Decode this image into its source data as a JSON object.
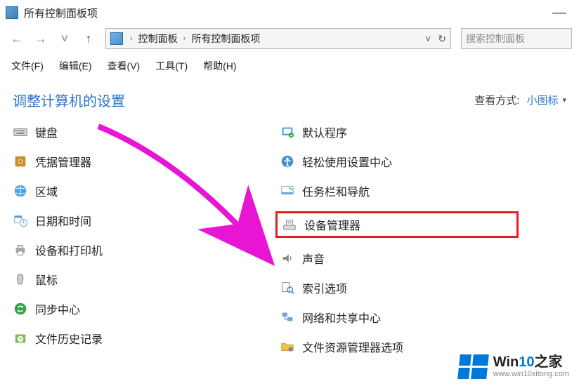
{
  "window": {
    "title": "所有控制面板项",
    "minimize": "—"
  },
  "nav": {
    "back_icon": "←",
    "forward_icon": "→",
    "up_icon": "↑",
    "dropdown_icon": "˅",
    "refresh_icon": "↻"
  },
  "breadcrumb": {
    "sep": "›",
    "items": [
      "控制面板",
      "所有控制面板项"
    ]
  },
  "search": {
    "placeholder": "搜索控制面板"
  },
  "menu": {
    "file": "文件(F)",
    "edit": "编辑(E)",
    "view": "查看(V)",
    "tools": "工具(T)",
    "help": "帮助(H)"
  },
  "heading": "调整计算机的设置",
  "view_by": {
    "label": "查看方式:",
    "value": "小图标",
    "tri": "▾"
  },
  "left_items": [
    {
      "name": "keyboard",
      "label": "键盘"
    },
    {
      "name": "credentials",
      "label": "凭据管理器"
    },
    {
      "name": "region",
      "label": "区域"
    },
    {
      "name": "date-time",
      "label": "日期和时间"
    },
    {
      "name": "devices-printers",
      "label": "设备和打印机"
    },
    {
      "name": "mouse",
      "label": "鼠标"
    },
    {
      "name": "sync-center",
      "label": "同步中心"
    },
    {
      "name": "file-history",
      "label": "文件历史记录"
    }
  ],
  "right_items": [
    {
      "name": "default-programs",
      "label": "默认程序"
    },
    {
      "name": "ease-of-access",
      "label": "轻松使用设置中心"
    },
    {
      "name": "taskbar-nav",
      "label": "任务栏和导航"
    },
    {
      "name": "device-manager",
      "label": "设备管理器",
      "highlight": true
    },
    {
      "name": "sound",
      "label": "声音"
    },
    {
      "name": "indexing",
      "label": "索引选项"
    },
    {
      "name": "network-sharing",
      "label": "网络和共享中心"
    },
    {
      "name": "explorer-options",
      "label": "文件资源管理器选项"
    }
  ],
  "watermark": {
    "title_a": "Win",
    "title_b": "10",
    "title_c": "之家",
    "url": "www.win10xitong.com"
  }
}
